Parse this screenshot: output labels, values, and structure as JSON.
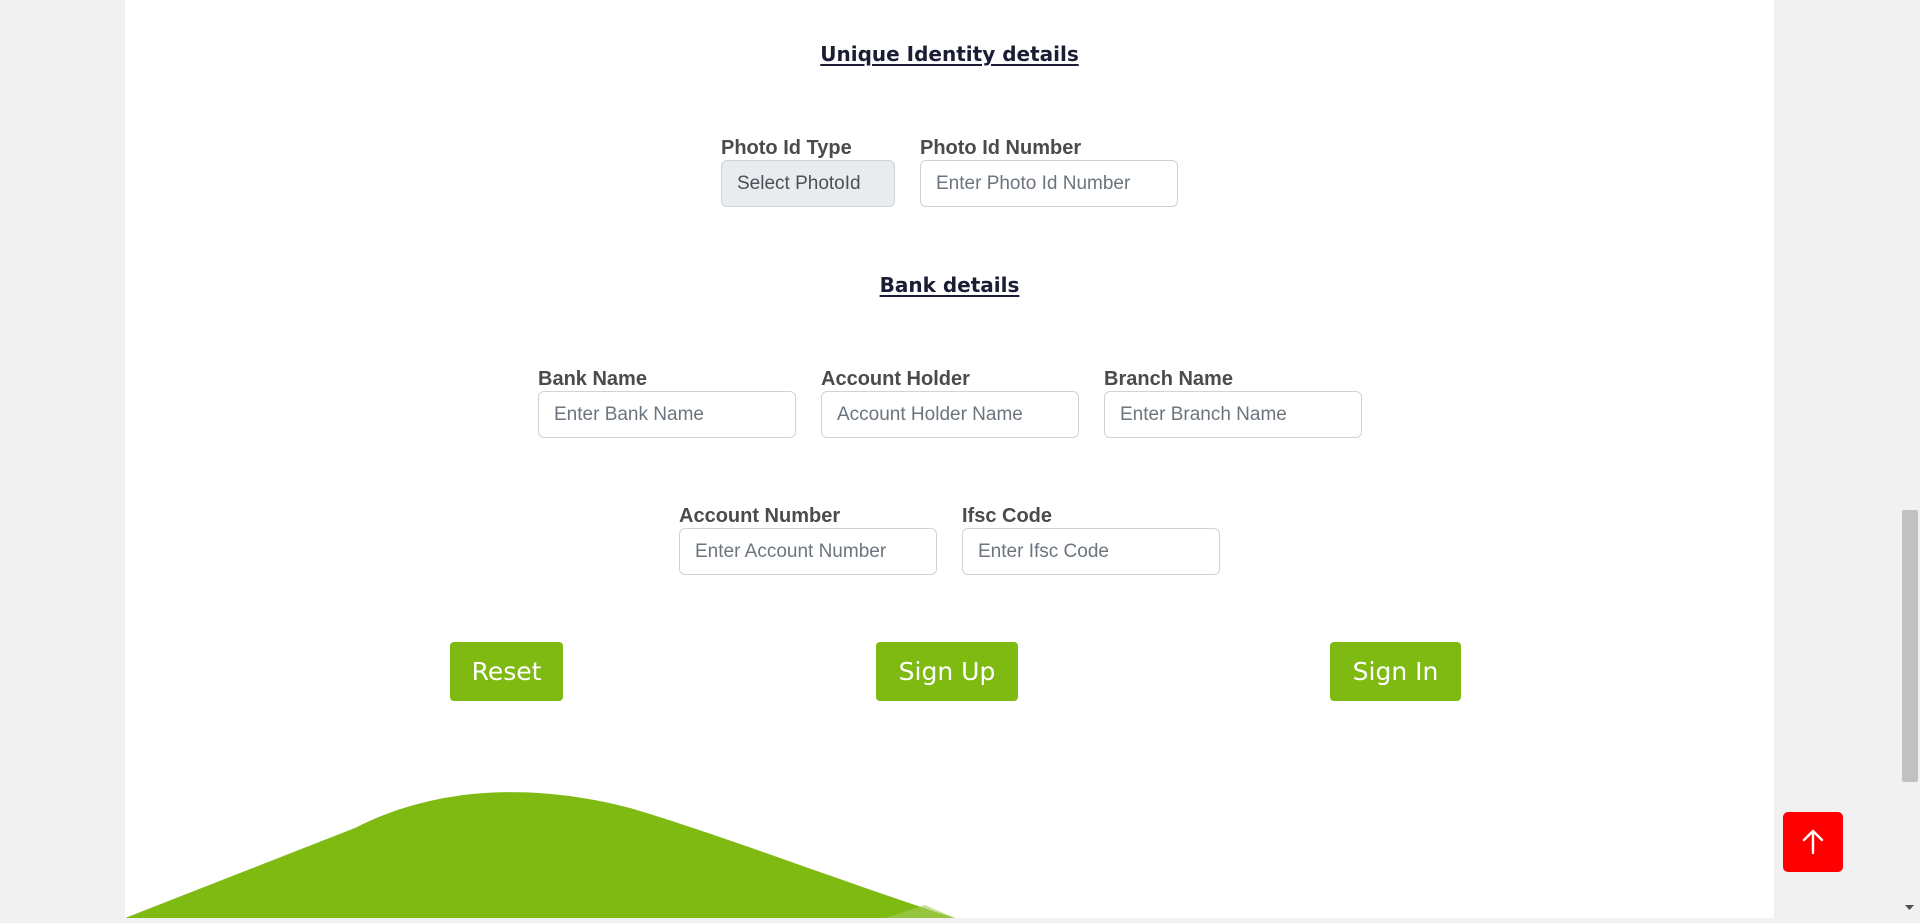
{
  "identity": {
    "heading": "Unique Identity details",
    "photo_id_type": {
      "label": "Photo Id Type",
      "value": "Select PhotoId"
    },
    "photo_id_number": {
      "label": "Photo Id Number",
      "placeholder": "Enter Photo Id Number"
    }
  },
  "bank": {
    "heading": "Bank details",
    "bank_name": {
      "label": "Bank Name",
      "placeholder": "Enter Bank Name"
    },
    "account_holder": {
      "label": "Account Holder",
      "placeholder": "Account Holder Name"
    },
    "branch_name": {
      "label": "Branch Name",
      "placeholder": "Enter Branch Name"
    },
    "account_number": {
      "label": "Account Number",
      "placeholder": "Enter Account Number"
    },
    "ifsc_code": {
      "label": "Ifsc Code",
      "placeholder": "Enter Ifsc Code"
    }
  },
  "buttons": {
    "reset": "Reset",
    "sign_up": "Sign Up",
    "sign_in": "Sign In"
  },
  "icons": {
    "scroll_top": "arrow-up-icon"
  },
  "colors": {
    "accent": "#7fba13",
    "scroll_top": "#ff0000",
    "heading": "#1a1d33"
  }
}
